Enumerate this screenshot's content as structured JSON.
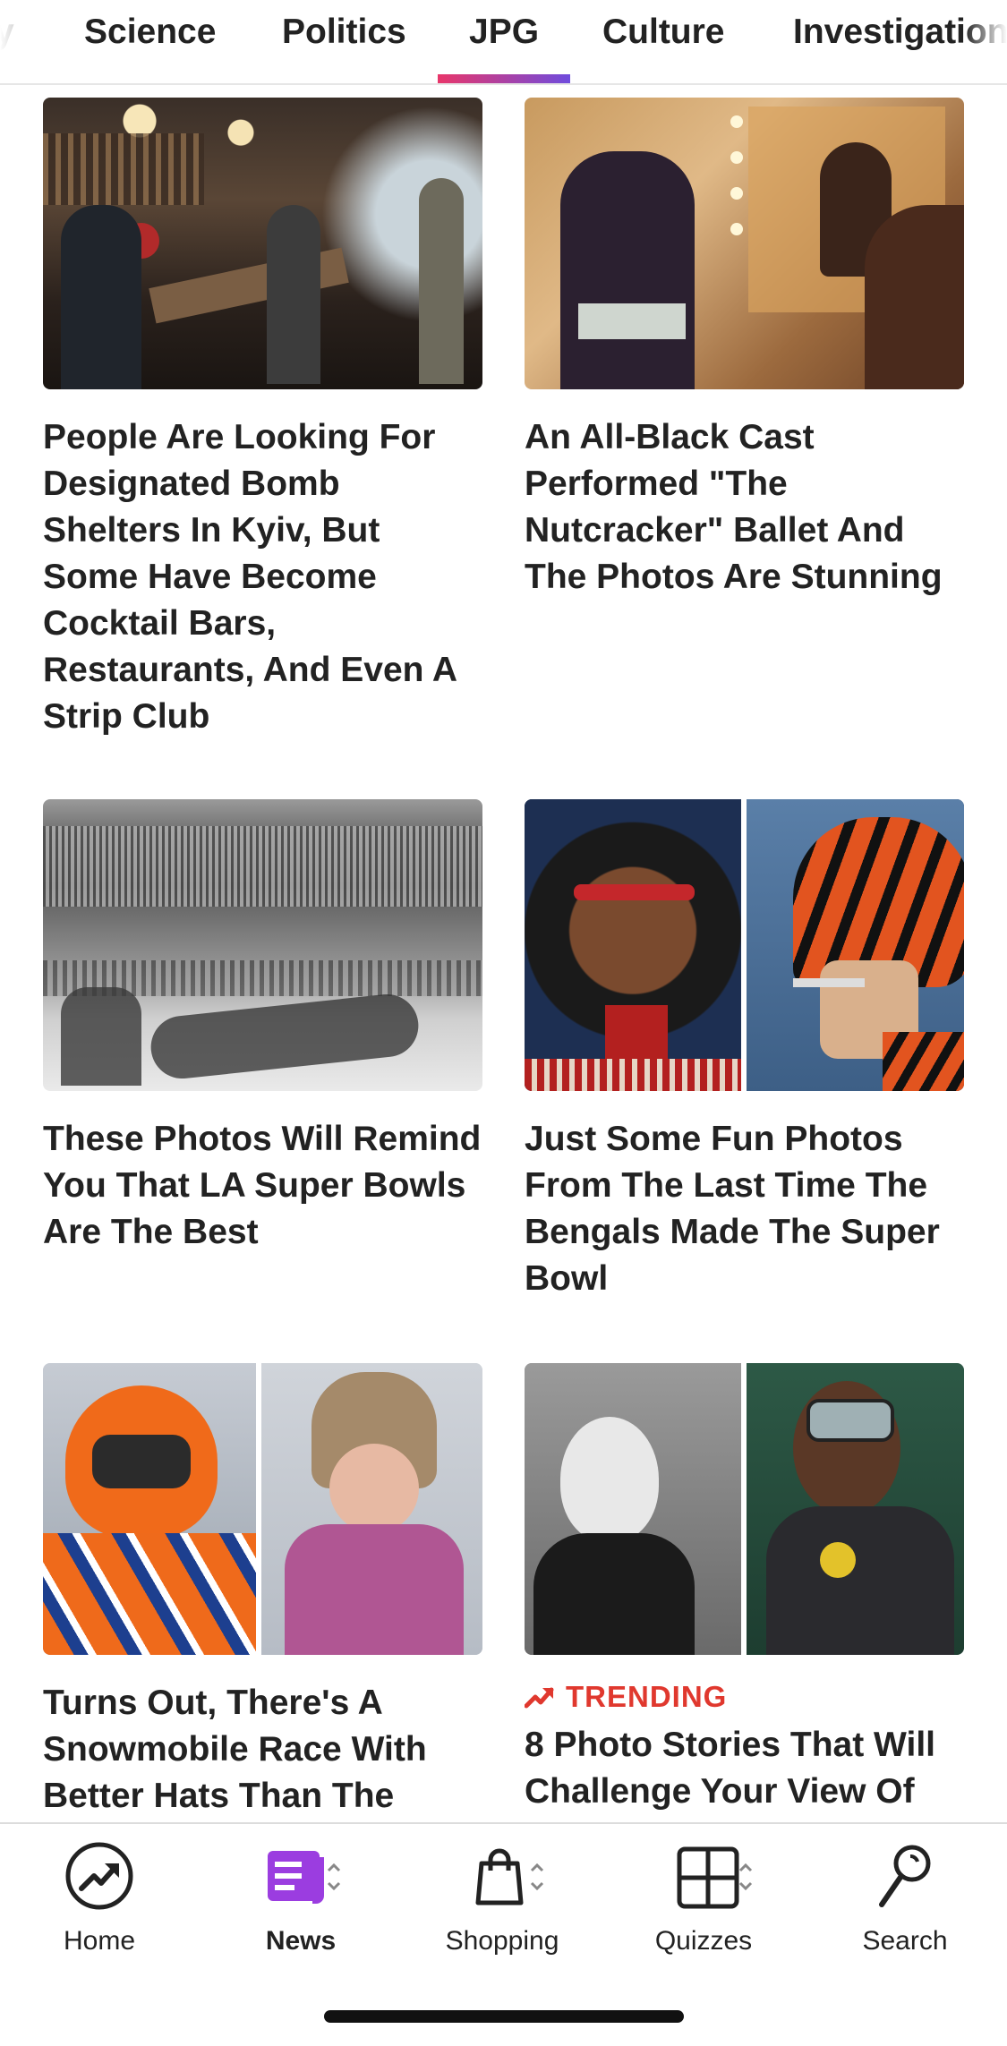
{
  "tabs": [
    {
      "label": "y",
      "active": false
    },
    {
      "label": "Science",
      "active": false
    },
    {
      "label": "Politics",
      "active": false
    },
    {
      "label": "JPG",
      "active": true
    },
    {
      "label": "Culture",
      "active": false
    },
    {
      "label": "Investigation",
      "active": false
    }
  ],
  "articles": [
    {
      "headline": "People Are Looking For Designated Bomb Shelters In Kyiv, But Some Have Become Cocktail Bars, Restaurants, And Even A Strip Club"
    },
    {
      "headline": "An All-Black Cast Performed \"The Nutcracker\" Ballet And The Photos Are Stunning"
    },
    {
      "headline": "These Photos Will Remind You That LA Super Bowls Are The Best"
    },
    {
      "headline": "Just Some Fun Photos From The Last Time The Bengals Made The Super Bowl"
    },
    {
      "headline": "Turns Out, There's A Snowmobile Race With Better Hats Than The"
    },
    {
      "headline": "8 Photo Stories That Will Challenge Your View Of",
      "badge": "TRENDING"
    }
  ],
  "bottom_nav": [
    {
      "label": "Home",
      "icon": "trending-circle-icon",
      "active": false
    },
    {
      "label": "News",
      "icon": "news-icon",
      "active": true
    },
    {
      "label": "Shopping",
      "icon": "shopping-bag-icon",
      "active": false
    },
    {
      "label": "Quizzes",
      "icon": "quiz-grid-icon",
      "active": false
    },
    {
      "label": "Search",
      "icon": "search-icon",
      "active": false
    }
  ],
  "colors": {
    "accent_gradient_start": "#e8366a",
    "accent_gradient_end": "#6f4cdd",
    "trending": "#e0382e",
    "news_icon": "#9b3de0"
  }
}
